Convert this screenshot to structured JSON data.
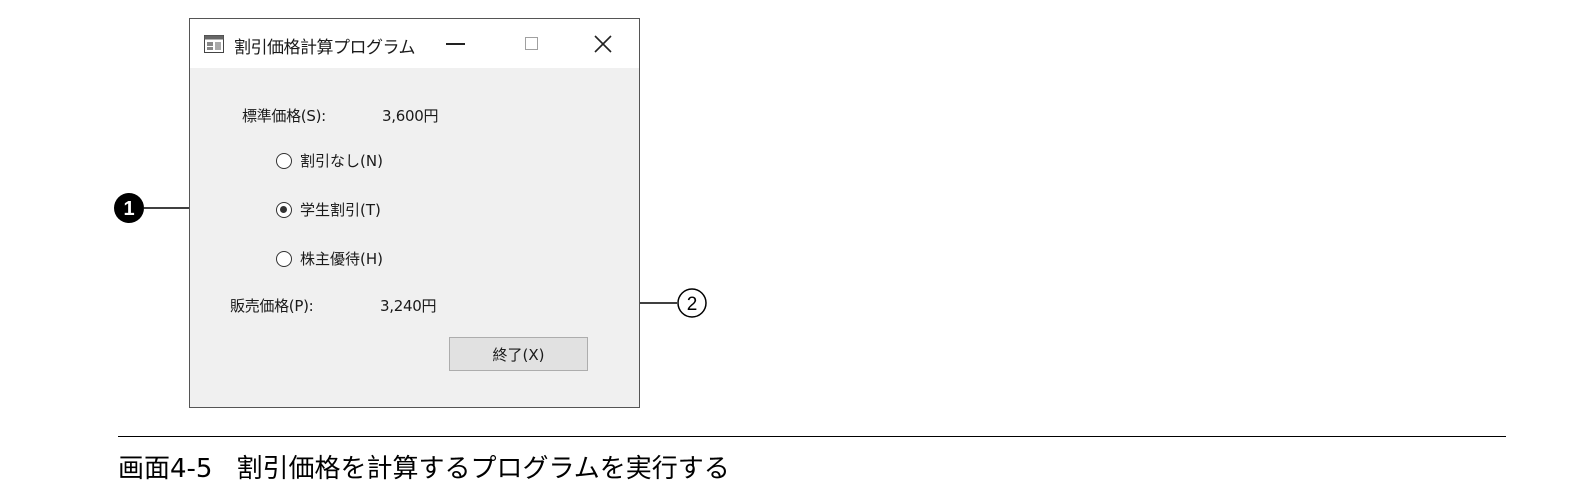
{
  "window": {
    "title": "割引価格計算プログラム",
    "icon": "form-app-icon",
    "controls": [
      "minimize-icon",
      "maximize-icon",
      "close-icon"
    ]
  },
  "form": {
    "standard_price_label": "標準価格(S):",
    "standard_price_value": "3,600円",
    "radios": [
      {
        "label": "割引なし(N)",
        "checked": false
      },
      {
        "label": "学生割引(T)",
        "checked": true
      },
      {
        "label": "株主優待(H)",
        "checked": false
      }
    ],
    "sale_price_label": "販売価格(P):",
    "sale_price_value": "3,240円",
    "end_button_label": "終了(X)"
  },
  "annotations": {
    "marker_1": "1",
    "marker_2": "2"
  },
  "caption": {
    "number": "画面4-5",
    "text": "割引価格を計算するプログラムを実行する"
  }
}
